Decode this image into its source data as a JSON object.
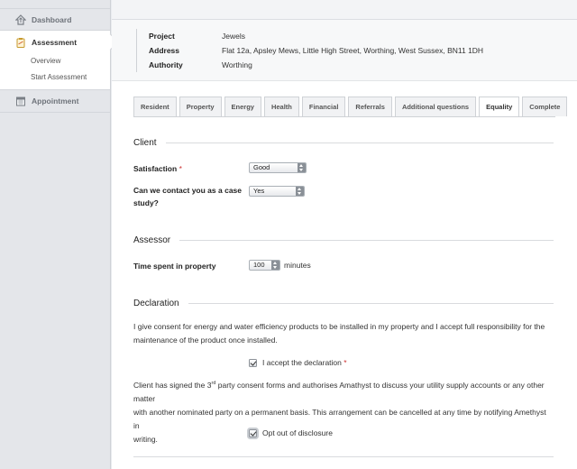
{
  "sidebar": {
    "items": [
      {
        "label": "Dashboard",
        "icon": "house-upload-icon"
      },
      {
        "label": "Assessment",
        "icon": "clipboard-icon",
        "active": true,
        "sub": [
          {
            "label": "Overview"
          },
          {
            "label": "Start Assessment"
          }
        ]
      },
      {
        "label": "Appointment",
        "icon": "calendar-icon"
      }
    ]
  },
  "info": {
    "rows": [
      {
        "key": "Project",
        "value": "Jewels"
      },
      {
        "key": "Address",
        "value": "Flat 12a, Apsley Mews, Little High Street, Worthing, West Sussex, BN11 1DH"
      },
      {
        "key": "Authority",
        "value": "Worthing"
      }
    ]
  },
  "tabs": [
    {
      "label": "Resident"
    },
    {
      "label": "Property"
    },
    {
      "label": "Energy"
    },
    {
      "label": "Health"
    },
    {
      "label": "Financial"
    },
    {
      "label": "Referrals"
    },
    {
      "label": "Additional questions"
    },
    {
      "label": "Equality",
      "active": true
    },
    {
      "label": "Complete"
    }
  ],
  "client": {
    "title": "Client",
    "satisfaction_label": "Satisfaction",
    "required_mark": "*",
    "satisfaction_value": "Good",
    "contact_label_line1": "Can we contact you as a case",
    "contact_label_line2": "study?",
    "contact_value": "Yes"
  },
  "assessor": {
    "title": "Assessor",
    "time_label": "Time spent in property",
    "time_value": "100",
    "time_unit": "minutes"
  },
  "declaration": {
    "title": "Declaration",
    "consent_line1": "I give consent for energy and water efficiency products to be installed in my property and I accept full responsibility for the",
    "consent_line2": "maintenance of the product once installed.",
    "accept_label": "I accept the declaration",
    "accept_required": "*",
    "thirdparty_pre": "Client has signed the 3",
    "thirdparty_sup": "rd",
    "thirdparty_post": " party consent forms and authorises Amathyst to discuss your utility supply accounts or any other matter",
    "thirdparty_line2": "with another nominated party on a permanent basis. This arrangement can be cancelled at any time by notifying Amethyst in",
    "thirdparty_line3": "writing.",
    "optout_label": "Opt out of disclosure"
  }
}
